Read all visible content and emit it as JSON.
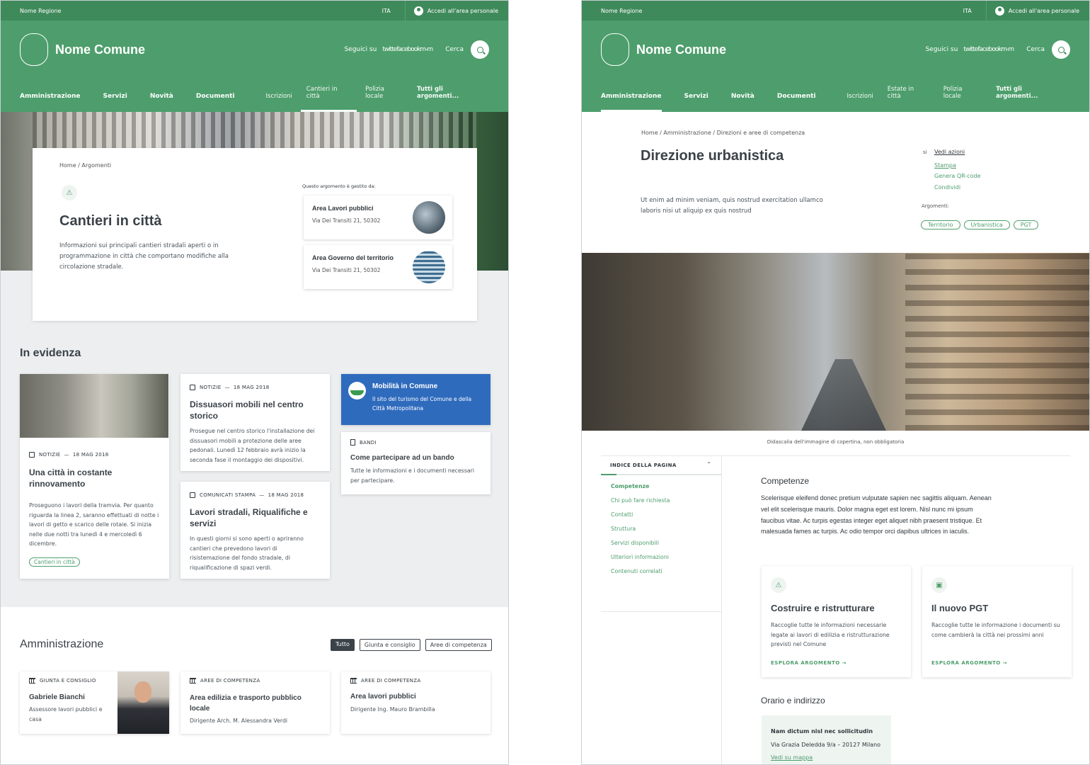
{
  "common": {
    "region": "Nome Regione",
    "lang": "ITA",
    "login": "Accedi all'area personale",
    "municipality": "Nome Comune",
    "follow": "Seguici su",
    "social": "twittefacebookm-m",
    "search_label": "Cerca",
    "nav_main": [
      "Amministrazione",
      "Servizi",
      "Novità",
      "Documenti"
    ],
    "all_topics": "Tutti gli argomenti..."
  },
  "left": {
    "nav_sub": [
      "Iscrizioni",
      "Cantieri in città",
      "Polizia locale"
    ],
    "breadcrumb": "Home / Argomenti",
    "title": "Cantieri in città",
    "description": "Informazioni sui principali cantieri stradali aperti o in programmazione in città che comportano modifiche alla circolazione stradale.",
    "managed_by": "Questo argomento è gestito da:",
    "areas": [
      {
        "title": "Area Lavori pubblici",
        "address": "Via Dei Transiti 21, 50302"
      },
      {
        "title": "Area Governo del territorio",
        "address": "Via Dei Transiti 21, 50302"
      }
    ],
    "highlight_title": "In evidenza",
    "news": [
      {
        "category": "NOTIZIE",
        "date": "18 MAG 2018",
        "title": "Una città in costante rinnovamento",
        "text": "Proseguono i lavori della tramvia. Per quanto riguarda la linea 2, saranno effettuati di notte i lavori di getto e scarico delle rotaie. Si inizia nelle due notti tra lunedì 4 e mercoledì 6 dicembre.",
        "chip": "Cantieri in città"
      },
      {
        "category": "NOTIZIE",
        "date": "18 MAG 2018",
        "title": "Dissuasori mobili nel centro storico",
        "text": "Prosegue nel centro storico l'installazione dei dissuasori mobili a protezione delle aree pedonali. Lunedì 12 febbraio avrà inizio la seconda fase il montaggio dei dispositivi."
      },
      {
        "category": "COMUNICATI STAMPA",
        "date": "18 MAG 2018",
        "title": "Lavori stradali, Riqualifiche e servizi",
        "text": "In questi giorni si sono aperti o apriranno cantieri che prevedono lavori di risistemazione del fondo stradale, di riqualificazione di spazi verdi."
      }
    ],
    "promo": {
      "title": "Mobilità in Comune",
      "text": "Il sito del turismo del Comune e della Città Metropolitana"
    },
    "bando": {
      "category": "BANDI",
      "title": "Come partecipare ad un bando",
      "text": "Tutte le informazioni e i documenti necessari per partecipare."
    },
    "admin_title": "Amministrazione",
    "filters": [
      "Tutto",
      "Giunta e consiglio",
      "Aree di competenza"
    ],
    "admin_cards": [
      {
        "category": "GIUNTA E CONSIGLIO",
        "title": "Gabriele Bianchi",
        "text": "Assessore lavori pubblici e casa"
      },
      {
        "category": "AREE DI COMPETENZA",
        "title": "Area edilizia e trasporto pubblico locale",
        "text": "Dirigente Arch. M. Alessandra Verdi"
      },
      {
        "category": "AREE DI COMPETENZA",
        "title": "Area lavori pubblici",
        "text": "Dirigente Ing. Mauro Brambilla"
      }
    ]
  },
  "right": {
    "nav_sub": [
      "Iscrizioni",
      "Estate in città",
      "Polizia locale"
    ],
    "breadcrumb": "Home / Amministrazione / Direzioni e aree di competenza",
    "title": "Direzione urbanistica",
    "description": "Ut enim ad minim veniam, quis nostrud exercitation ullamco laboris nisi ut aliquip ex quis nostrud",
    "actions_prefix": "si",
    "actions": [
      "Vedi azioni",
      "Stampa",
      "Genera QR-code",
      "Condividi"
    ],
    "topics_label": "Argomenti:",
    "topics": [
      "Territorio",
      "Urbanistica",
      "PGT"
    ],
    "caption": "Didascalia dell'immagine di copertina, non obbligatoria",
    "toc_title": "INDICE DELLA PAGINA",
    "toc": [
      "Competenze",
      "Chi può fare richiesta",
      "Contatti",
      "Struttura",
      "Servizi disponibili",
      "Ulteriori informazioni",
      "Contenuti correlati"
    ],
    "competenze_title": "Competenze",
    "competenze_text": "Scelerisque eleifend donec pretium vulputate sapien nec sagittis aliquam. Aenean vel elit scelerisque mauris. Dolor magna eget est lorem. Nisl nunc mi ipsum faucibus vitae. Ac turpis egestas integer eget aliquet nibh praesent tristique. Et malesuada fames ac turpis. Ac odio tempor orci dapibus ultrices in iaculis.",
    "topic_cards": [
      {
        "title": "Costruire e ristrutturare",
        "text": "Raccoglie tutte le informazioni necessarie legate ai lavori di edilizia e ristrutturazione previsti nel Comune",
        "link": "ESPLORA ARGOMENTO →"
      },
      {
        "title": "Il nuovo PGT",
        "text": "Raccoglie tutte le informazione i documenti su come cambierà la città nei prossimi anni",
        "link": "ESPLORA ARGOMENTO →"
      }
    ],
    "hours_title": "Orario e indirizzo",
    "address_card": {
      "title": "Nam dictum nisl nec sollicitudin",
      "address": "Via Grazia Deledda 9/a – 20127 Milano",
      "link": "Vedi su mappa"
    }
  }
}
